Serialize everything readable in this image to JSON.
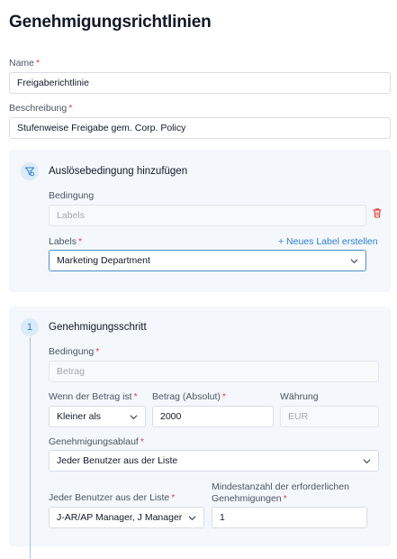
{
  "page": {
    "title": "Genehmigungsrichtlinien"
  },
  "form": {
    "name": {
      "label": "Name",
      "required_mark": "*",
      "value": "Freigaberichtlinie"
    },
    "description": {
      "label": "Beschreibung",
      "required_mark": "*",
      "value": "Stufenweise Freigabe gem. Corp. Policy"
    }
  },
  "trigger": {
    "title": "Auslösebedingung hinzufügen",
    "condition": {
      "label": "Bedingung",
      "placeholder": "Labels"
    },
    "labels": {
      "label": "Labels",
      "required_mark": "*",
      "value": "Marketing Department"
    },
    "new_label_link": "+ Neues Label erstellen"
  },
  "step": {
    "number": "1",
    "title": "Genehmigungsschritt",
    "condition": {
      "label": "Bedingung",
      "required_mark": "*",
      "placeholder": "Betrag"
    },
    "if_amount": {
      "label": "Wenn der Betrag ist",
      "required_mark": "*",
      "value": "Kleiner als"
    },
    "amount": {
      "label": "Betrag (Absolut)",
      "required_mark": "*",
      "value": "2000"
    },
    "currency": {
      "label": "Währung",
      "placeholder": "EUR"
    },
    "flow": {
      "label": "Genehmigungsablauf",
      "required_mark": "*",
      "value": "Jeder Benutzer aus der Liste"
    },
    "user_list": {
      "label": "Jeder Benutzer aus der Liste",
      "required_mark": "*",
      "value": "J-AR/AP Manager, J Manager"
    },
    "min_approvals": {
      "label_line1": "Mindestanzahl der erforderlichen",
      "label_line2": "Genehmigungen",
      "required_mark": "*",
      "value": "1"
    }
  },
  "colors": {
    "accent": "#2f7fd1",
    "required": "#e0453a",
    "panel": "#f4f7fb",
    "delete": "#e0453a"
  },
  "icons": {
    "trigger": "filter-icon",
    "delete": "trash-icon",
    "dropdown": "chevron-down-icon"
  }
}
